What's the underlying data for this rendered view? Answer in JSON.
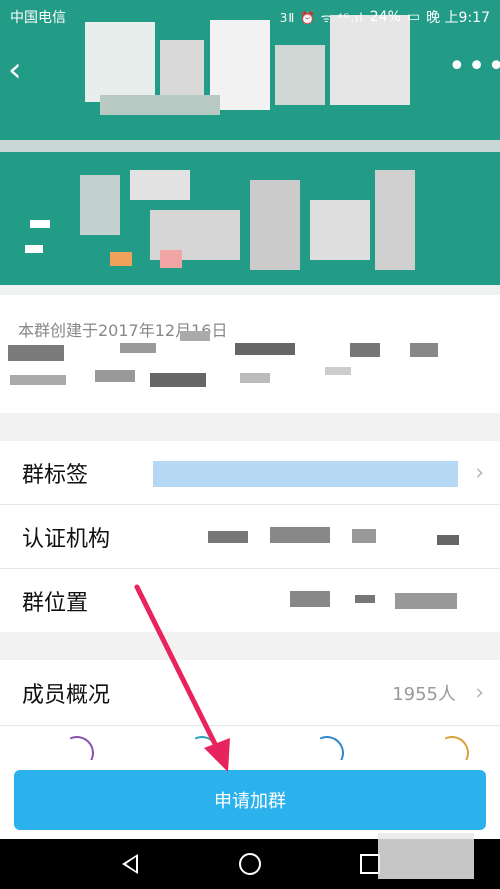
{
  "status_bar": {
    "carrier": "中国电信",
    "icons": "3Ⅱ ⏰ ᯤ ⁴ᴳ.ıl",
    "battery": "24%",
    "time": "晚 上9:17"
  },
  "header": {
    "back_icon": "chevron-left-icon",
    "more_icon": "more-dots-icon",
    "banner_color": "#239c87"
  },
  "description": {
    "text": "本群创建于2017年12月16日"
  },
  "info_rows": [
    {
      "label": "群标签"
    },
    {
      "label": "认证机构"
    },
    {
      "label": "群位置"
    }
  ],
  "members": {
    "label": "成员概况",
    "count": "1955人"
  },
  "join_button": {
    "label": "申请加群",
    "color": "#2bb1ec"
  },
  "navbar": {
    "back_icon": "nav-back-icon",
    "home_icon": "nav-home-icon",
    "recent_icon": "nav-recent-icon"
  },
  "annotation": {
    "color": "#e8245e"
  }
}
